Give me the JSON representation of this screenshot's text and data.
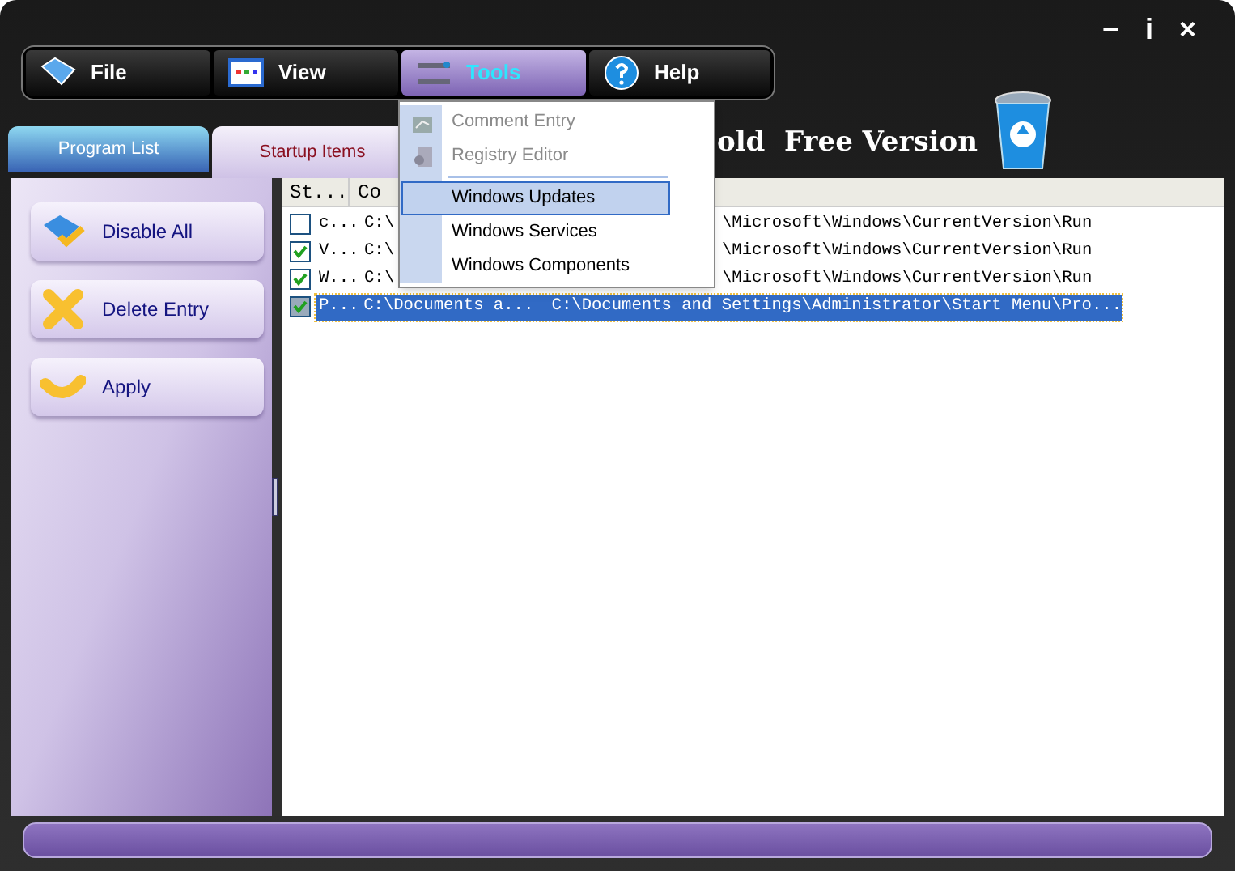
{
  "window_controls": [
    "−",
    "i",
    "×"
  ],
  "toolbar": [
    {
      "label": "File",
      "selected": false
    },
    {
      "label": "View",
      "selected": false
    },
    {
      "label": "Tools",
      "selected": true
    },
    {
      "label": "Help",
      "selected": false
    }
  ],
  "app_title": "old  Free Version",
  "tabs": [
    {
      "label": "Program List",
      "selected": false
    },
    {
      "label": "Startup Items",
      "selected": true
    }
  ],
  "actions": [
    {
      "label": "Disable All"
    },
    {
      "label": "Delete Entry"
    },
    {
      "label": "Apply"
    }
  ],
  "table": {
    "columns": [
      "St...",
      "Co"
    ],
    "rows": [
      {
        "checked": false,
        "selected": false,
        "cells": [
          "c...",
          "C:\\",
          "\\Microsoft\\Windows\\CurrentVersion\\Run"
        ]
      },
      {
        "checked": true,
        "selected": false,
        "cells": [
          "V...",
          "C:\\",
          "\\Microsoft\\Windows\\CurrentVersion\\Run"
        ]
      },
      {
        "checked": true,
        "selected": false,
        "cells": [
          "W...",
          "C:\\",
          "\\Microsoft\\Windows\\CurrentVersion\\Run"
        ]
      },
      {
        "checked": true,
        "selected": true,
        "cells": [
          "P...",
          "C:\\Documents a...",
          "C:\\Documents and Settings\\Administrator\\Start Menu\\Pro..."
        ]
      }
    ]
  },
  "tools_menu": [
    {
      "label": "Comment Entry",
      "disabled": true,
      "selected": false
    },
    {
      "label": "Registry Editor",
      "disabled": true,
      "selected": false
    },
    {
      "label": "Windows Updates",
      "disabled": false,
      "selected": true
    },
    {
      "label": "Windows Services",
      "disabled": false,
      "selected": false
    },
    {
      "label": "Windows Components",
      "disabled": false,
      "selected": false
    }
  ]
}
